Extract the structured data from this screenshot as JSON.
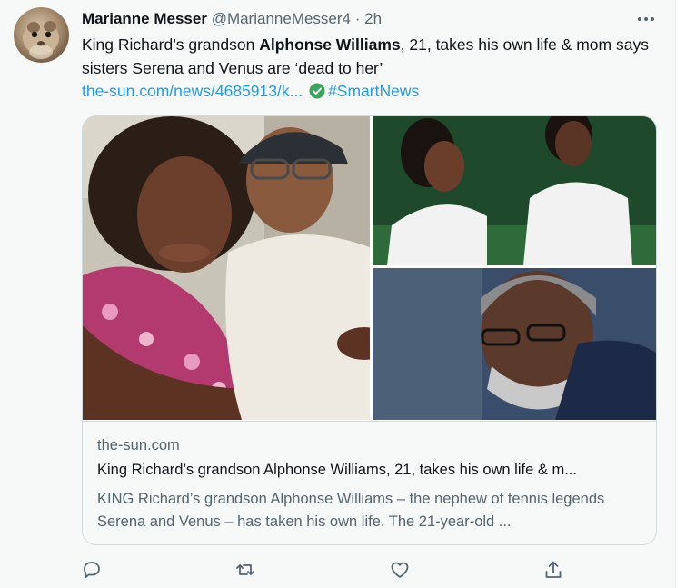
{
  "tweet": {
    "author_name": "Marianne Messer",
    "handle": "@MarianneMesser4",
    "separator": " · ",
    "time": "2h",
    "text_part1": "King Richard’s grandson ",
    "text_bold": "Alphonse Williams",
    "text_part2": ", 21, takes his own life & mom says sisters Serena and Venus are ‘dead to her’",
    "link_text": "the-sun.com/news/4685913/k...",
    "hashtag": "#SmartNews"
  },
  "card": {
    "domain": "the-sun.com",
    "title": "King Richard’s grandson Alphonse Williams, 21, takes his own life & m...",
    "description": "KING Richard’s grandson Alphonse Williams – the nephew of tennis legends Serena and Venus – has taken his own life. The 21-year-old ..."
  },
  "icons": {
    "more": "more-icon",
    "reply": "reply-icon",
    "retweet": "retweet-icon",
    "like": "like-icon",
    "share": "share-icon",
    "verified_link": "check-circle-icon"
  },
  "colors": {
    "link": "#1d9bf0",
    "text": "#0f1419",
    "secondary": "#536471",
    "background": "#f7f9f9",
    "check_green": "#3aa55d"
  }
}
